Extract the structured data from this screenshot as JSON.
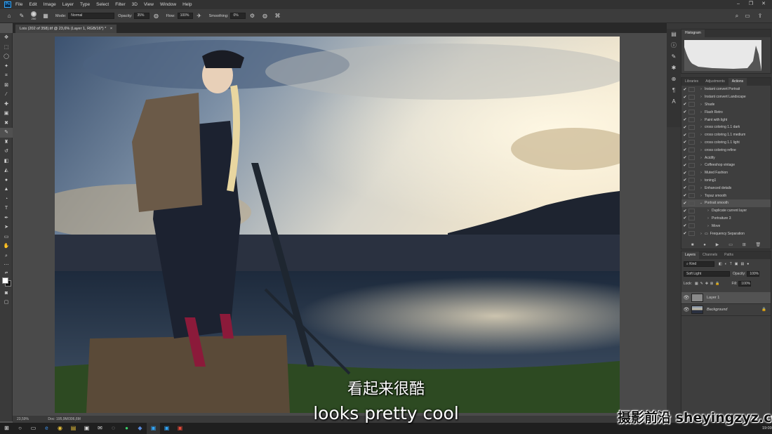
{
  "app": {
    "logo": "Ps"
  },
  "menu": [
    "File",
    "Edit",
    "Image",
    "Layer",
    "Type",
    "Select",
    "Filter",
    "3D",
    "View",
    "Window",
    "Help"
  ],
  "window_controls": [
    "–",
    "❐",
    "✕"
  ],
  "options_bar": {
    "brush_size": "250",
    "mode_label": "Mode:",
    "mode_value": "Normal",
    "opacity_label": "Opacity:",
    "opacity_value": "35%",
    "flow_label": "Flow:",
    "flow_value": "100%",
    "smoothing_label": "Smoothing:",
    "smoothing_value": "0%"
  },
  "document": {
    "tab_title": "Lois (202 of 358).tif @ 23,6% (Layer 1, RGB/16*) *",
    "tab_close": "×",
    "zoom": "23,59%",
    "doc_size": "Doc: 195,9M/306,6M"
  },
  "histogram": {
    "tab": "Histogram"
  },
  "actions_panel": {
    "tabs": [
      "Libraries",
      "Adjustments",
      "Actions"
    ],
    "active_tab": "Actions",
    "items": [
      {
        "label": "Instant convert Portrait",
        "level": 0,
        "checked": true
      },
      {
        "label": "Instant convert Landscape",
        "level": 0,
        "checked": true
      },
      {
        "label": "Shade",
        "level": 0,
        "checked": true
      },
      {
        "label": "Flash Retro",
        "level": 0,
        "checked": true
      },
      {
        "label": "Paint with light",
        "level": 0,
        "checked": true
      },
      {
        "label": "cross coloring 1.1 dark",
        "level": 0,
        "checked": true
      },
      {
        "label": "cross coloring 1.1 medium",
        "level": 0,
        "checked": true
      },
      {
        "label": "cross coloring 1.1 light",
        "level": 0,
        "checked": true
      },
      {
        "label": "cross coloring refine",
        "level": 0,
        "checked": true
      },
      {
        "label": "Acidify",
        "level": 0,
        "checked": true
      },
      {
        "label": "Coffeeshop vintage",
        "level": 0,
        "checked": true
      },
      {
        "label": "Muted Fashion",
        "level": 0,
        "checked": true
      },
      {
        "label": "toning1",
        "level": 0,
        "checked": true
      },
      {
        "label": "Enhanced details",
        "level": 0,
        "checked": true
      },
      {
        "label": "Topaz smooth",
        "level": 0,
        "checked": true
      },
      {
        "label": "Portrait smooth",
        "level": 0,
        "checked": true,
        "expanded": true,
        "selected": true
      },
      {
        "label": "Duplicate current layer",
        "level": 1,
        "checked": true
      },
      {
        "label": "Portraiture 3",
        "level": 1,
        "checked": true
      },
      {
        "label": "Move",
        "level": 1,
        "checked": true
      },
      {
        "label": "Frequency Separation",
        "level": 0,
        "checked": true,
        "folder": true
      }
    ]
  },
  "layers_panel": {
    "tabs": [
      "Layers",
      "Channels",
      "Paths"
    ],
    "active_tab": "Layers",
    "kind_label": "Kind",
    "blend_mode": "Soft Light",
    "opacity_label": "Opacity:",
    "opacity_value": "100%",
    "lock_label": "Lock:",
    "fill_label": "Fill:",
    "fill_value": "100%",
    "layers": [
      {
        "name": "Layer 1",
        "selected": true,
        "locked": false
      },
      {
        "name": "Background",
        "selected": false,
        "locked": true
      }
    ]
  },
  "subtitles": {
    "chinese": "看起来很酷",
    "english": "looks pretty cool"
  },
  "watermark": "摄影前沿 sheyingzyz.com",
  "taskbar": {
    "clock": "19:09"
  }
}
